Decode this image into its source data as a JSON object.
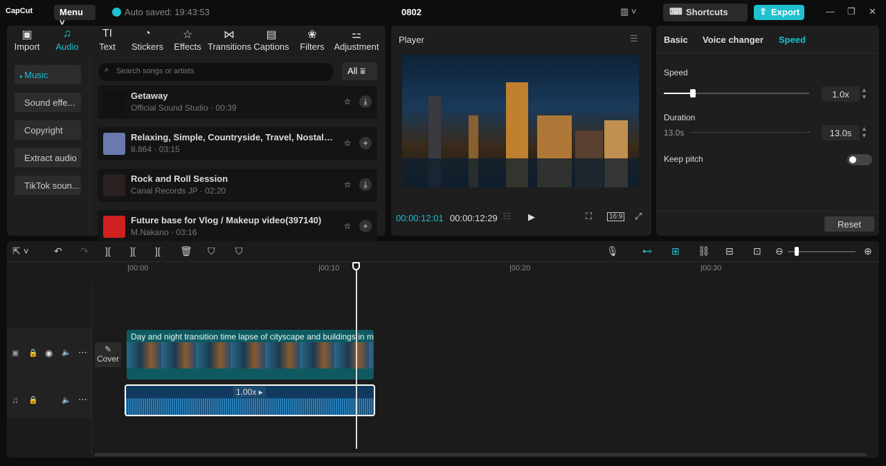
{
  "app": {
    "logo": "CapCut",
    "menu": "Menu",
    "autosave": "Auto saved: 19:43:53",
    "title": "0802",
    "shortcuts": "Shortcuts",
    "export": "Export"
  },
  "tabs": [
    {
      "label": "Import",
      "icon": "▣"
    },
    {
      "label": "Audio",
      "icon": "♫"
    },
    {
      "label": "Text",
      "icon": "TI"
    },
    {
      "label": "Stickers",
      "icon": "◔"
    },
    {
      "label": "Effects",
      "icon": "☆"
    },
    {
      "label": "Transitions",
      "icon": "⋈"
    },
    {
      "label": "Captions",
      "icon": "▤"
    },
    {
      "label": "Filters",
      "icon": "❀"
    },
    {
      "label": "Adjustment",
      "icon": "⚍"
    }
  ],
  "sidebar": [
    "Music",
    "Sound effe...",
    "Copyright",
    "Extract audio",
    "TikTok soun..."
  ],
  "search": {
    "placeholder": "Search songs or artists",
    "filter": "All"
  },
  "songs": [
    {
      "name": "Getaway",
      "meta": "Official Sound Studio · 00:39",
      "action": "⤓",
      "thumb": "#111"
    },
    {
      "name": "Relaxing, Simple, Countryside, Travel, Nostalgic",
      "meta": "8.864 · 03:15",
      "action": "+",
      "thumb": "#6a7ab0"
    },
    {
      "name": "Rock and Roll Session",
      "meta": "Canal Records JP · 02:20",
      "action": "⤓",
      "thumb": "#2a2020"
    },
    {
      "name": "Future base for Vlog / Makeup video(397140)",
      "meta": "M.Nakano · 03:16",
      "action": "+",
      "thumb": "#d02020"
    }
  ],
  "player": {
    "title": "Player",
    "current": "00:00:12:01",
    "total": "00:00:12:29",
    "ratio": "16:9"
  },
  "right": {
    "tabs": [
      "Basic",
      "Voice changer",
      "Speed"
    ],
    "speed_label": "Speed",
    "speed_value": "1.0x",
    "duration_label": "Duration",
    "duration_from": "13.0s",
    "duration_to": "13.0s",
    "keep_pitch": "Keep pitch",
    "reset": "Reset"
  },
  "timeline": {
    "ticks": [
      "|00:00",
      "|00:10",
      "|00:20",
      "|00:30"
    ],
    "clip_title": "Day and night transition time lapse of cityscape and buildings in m",
    "cover": "Cover",
    "audio_speed": "1.00x"
  }
}
